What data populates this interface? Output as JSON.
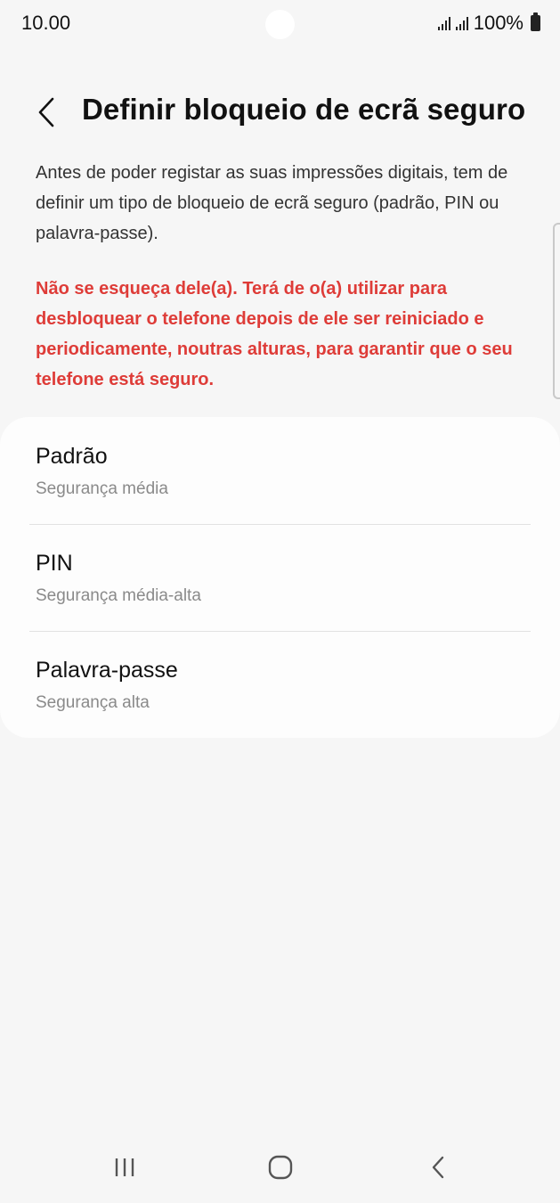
{
  "status_bar": {
    "time": "10.00",
    "battery_text": "100%",
    "icons": [
      "signal-icon",
      "signal-icon",
      "battery-icon"
    ]
  },
  "header": {
    "back_icon": "chevron-left-icon",
    "title": "Definir bloqueio de ecrã seguro"
  },
  "description": "Antes de poder registar as suas impressões digitais, tem de definir um tipo de bloqueio de ecrã seguro (padrão, PIN ou palavra-passe).",
  "warning": "Não se esqueça dele(a). Terá de o(a) utilizar para desbloquear o telefone depois de ele ser reiniciado e periodicamente, noutras alturas, para garantir que o seu telefone está seguro.",
  "options": [
    {
      "title": "Padrão",
      "subtitle": "Segurança média"
    },
    {
      "title": "PIN",
      "subtitle": "Segurança média-alta"
    },
    {
      "title": "Palavra-passe",
      "subtitle": "Segurança alta"
    }
  ],
  "navigation": {
    "icons": [
      "recent-apps-icon",
      "home-icon",
      "back-icon"
    ]
  },
  "colors": {
    "background": "#f6f6f6",
    "card": "#fdfdfd",
    "warning": "#de3c38"
  }
}
